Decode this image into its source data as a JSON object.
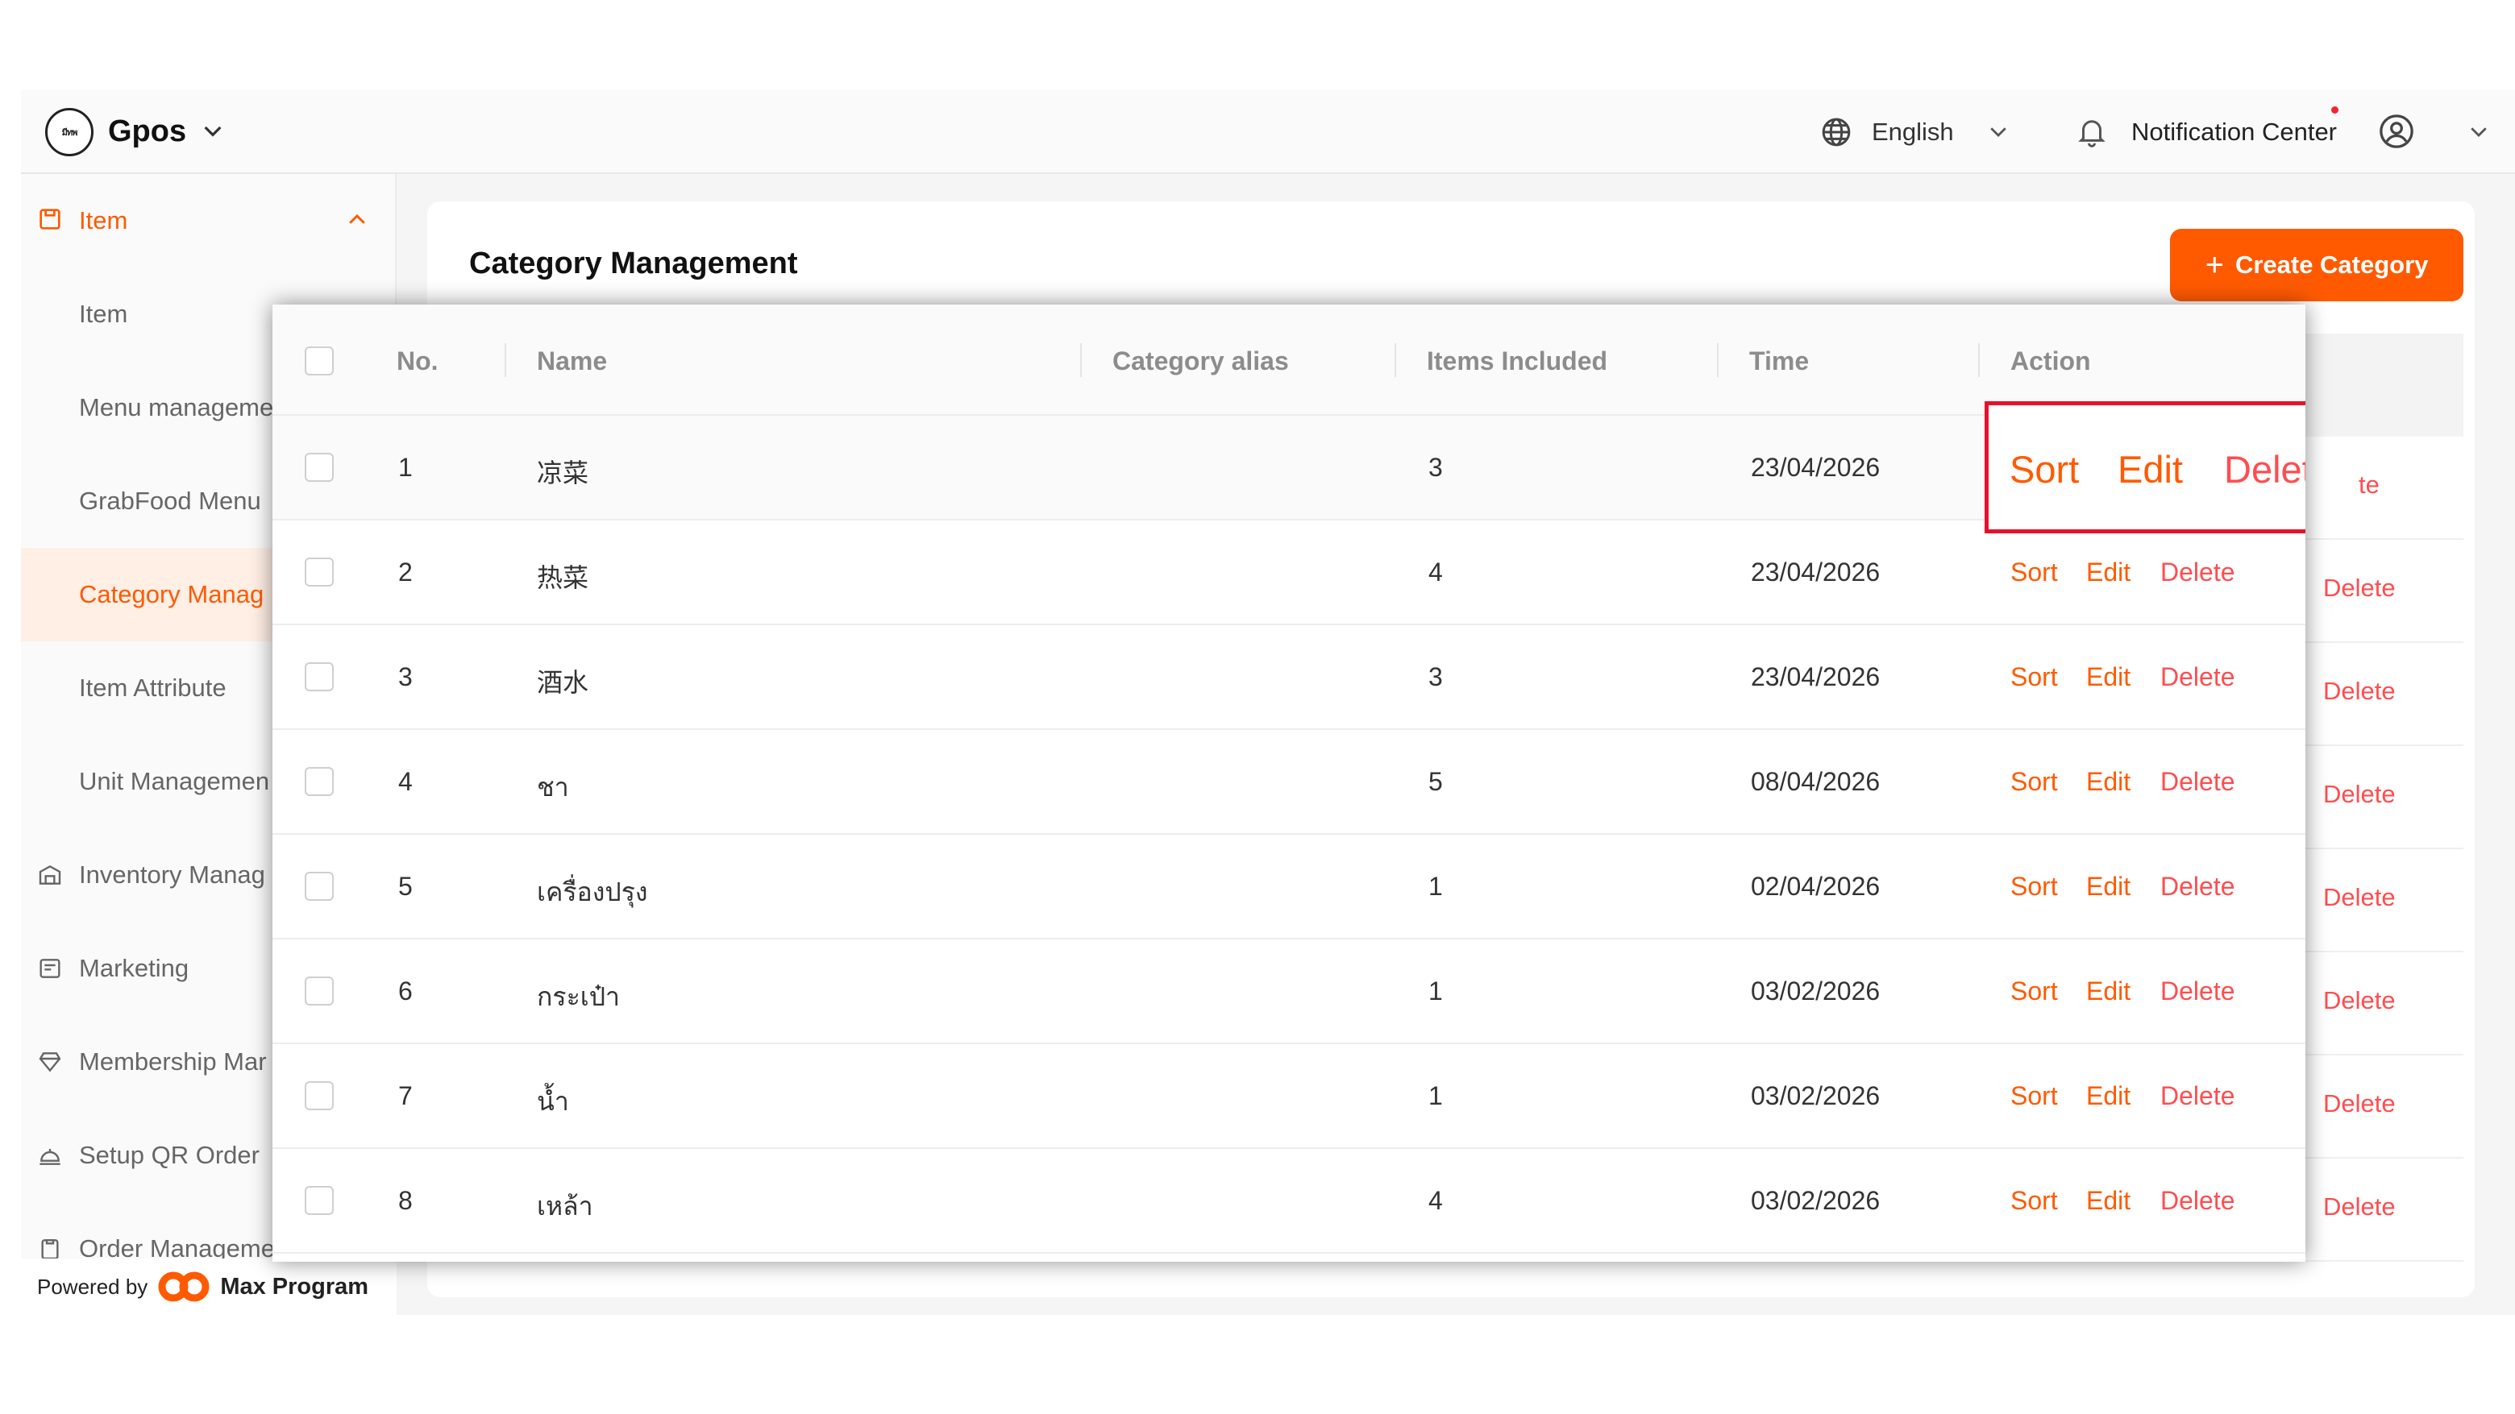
{
  "brand": {
    "name": "Gpos",
    "logo_text": "มีทพ"
  },
  "topbar": {
    "language": "English",
    "notification": "Notification Center"
  },
  "sidebar": {
    "group": "Item",
    "items": [
      {
        "label": "Item"
      },
      {
        "label": "Menu manageme"
      },
      {
        "label": "GrabFood Menu"
      },
      {
        "label": "Category Manag"
      },
      {
        "label": "Item Attribute"
      },
      {
        "label": "Unit Managemen"
      }
    ],
    "sections": [
      {
        "label": "Inventory Manag"
      },
      {
        "label": "Marketing"
      },
      {
        "label": "Membership Mar"
      },
      {
        "label": "Setup QR Order"
      },
      {
        "label": "Order Manageme"
      }
    ],
    "powered_by": "Powered by",
    "powered_brand": "Max Program"
  },
  "page": {
    "title": "Category Management",
    "create_button": "Create Category",
    "create_plus": "+"
  },
  "background_actions": [
    "te",
    "Delete",
    "Delete",
    "Delete",
    "Delete",
    "Delete",
    "Delete",
    "Delete"
  ],
  "table": {
    "headers": {
      "no": "No.",
      "name": "Name",
      "alias": "Category alias",
      "items": "Items Included",
      "time": "Time",
      "action": "Action"
    },
    "rows": [
      {
        "no": "1",
        "name": "凉菜",
        "alias": "",
        "items": "3",
        "time": "23/04/2026"
      },
      {
        "no": "2",
        "name": "热菜",
        "alias": "",
        "items": "4",
        "time": "23/04/2026"
      },
      {
        "no": "3",
        "name": "酒水",
        "alias": "",
        "items": "3",
        "time": "23/04/2026"
      },
      {
        "no": "4",
        "name": "ชา",
        "alias": "",
        "items": "5",
        "time": "08/04/2026"
      },
      {
        "no": "5",
        "name": "เครื่องปรุง",
        "alias": "",
        "items": "1",
        "time": "02/04/2026"
      },
      {
        "no": "6",
        "name": "กระเป๋า",
        "alias": "",
        "items": "1",
        "time": "03/02/2026"
      },
      {
        "no": "7",
        "name": "น้ำ",
        "alias": "",
        "items": "1",
        "time": "03/02/2026"
      },
      {
        "no": "8",
        "name": "เหล้า",
        "alias": "",
        "items": "4",
        "time": "03/02/2026"
      }
    ],
    "actions": {
      "sort": "Sort",
      "edit": "Edit",
      "delete": "Delete"
    }
  },
  "colors": {
    "accent": "#ff5a00",
    "danger": "#ff4d4f",
    "highlight_box": "#e8102a"
  }
}
